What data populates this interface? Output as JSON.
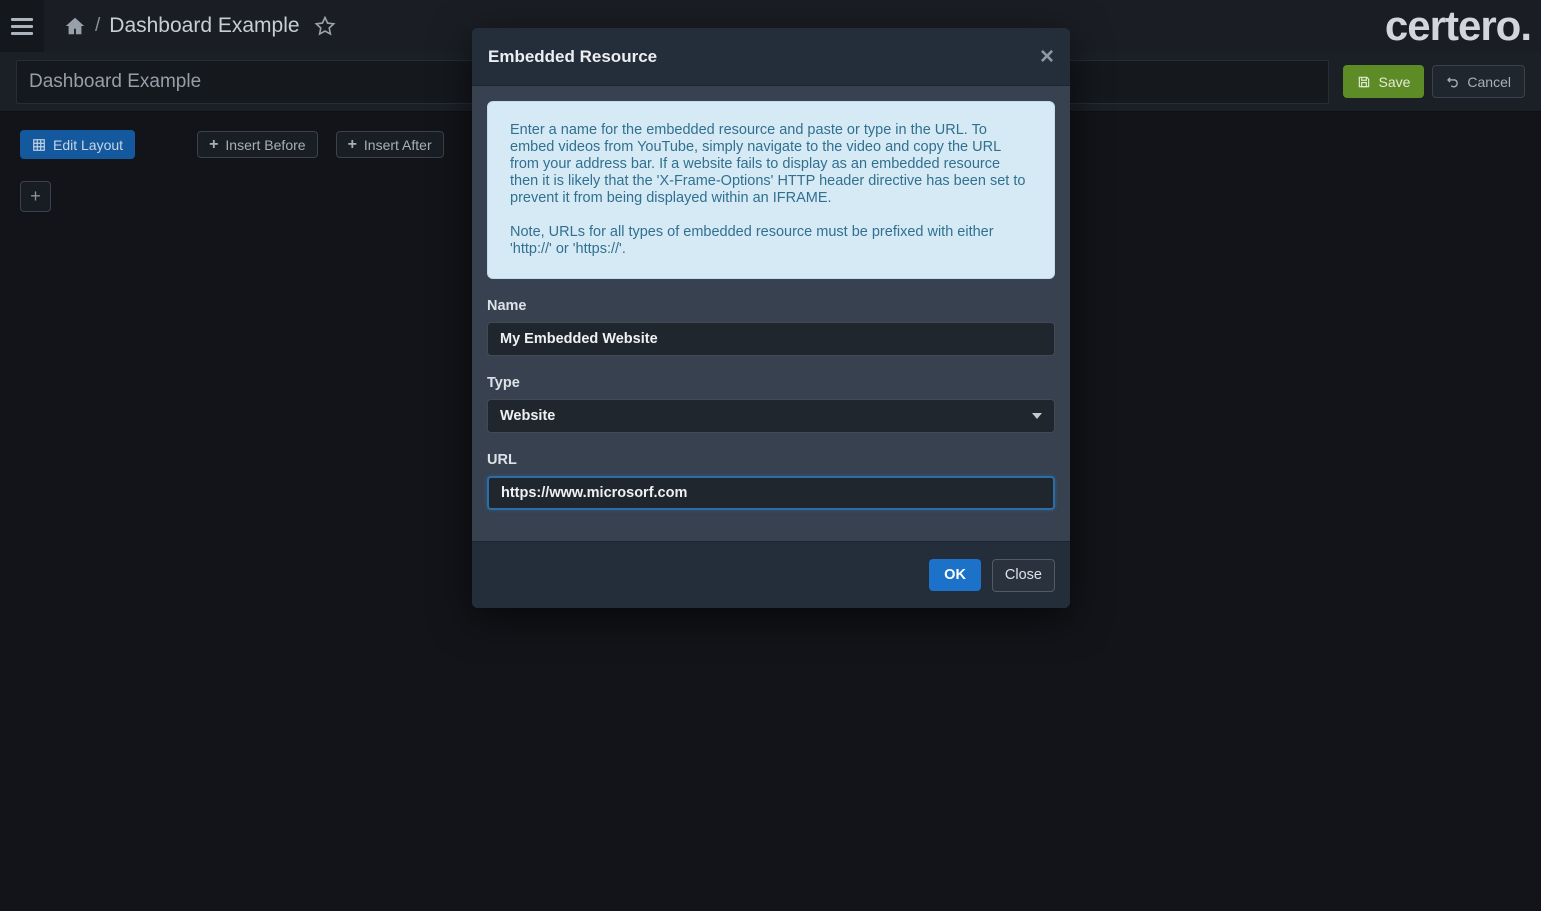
{
  "topbar": {
    "breadcrumb_separator": "/",
    "breadcrumb_title": "Dashboard Example",
    "logo": "certero."
  },
  "toolbar": {
    "title_value": "Dashboard Example",
    "save_label": "Save",
    "cancel_label": "Cancel"
  },
  "actions": {
    "edit_layout_label": "Edit Layout",
    "insert_before_label": "Insert Before",
    "insert_after_label": "Insert After",
    "plus_glyph": "+",
    "add_tile_label": "+"
  },
  "modal": {
    "title": "Embedded Resource",
    "close_glyph": "×",
    "info_paragraph1": "Enter a name for the embedded resource and paste or type in the URL. To embed videos from YouTube, simply navigate to the video and copy the URL from your address bar. If a website fails to display as an embedded resource then it is likely that the 'X-Frame-Options' HTTP header directive has been set to prevent it from being displayed within an IFRAME.",
    "info_paragraph2": "Note, URLs for all types of embedded resource must be prefixed with either 'http://' or 'https://'.",
    "fields": {
      "name_label": "Name",
      "name_value": "My Embedded Website",
      "type_label": "Type",
      "type_value": "Website",
      "url_label": "URL",
      "url_value": "https://www.microsorf.com"
    },
    "ok_label": "OK",
    "close_label": "Close"
  },
  "colors": {
    "accent_blue": "#1b72c8",
    "save_green": "#5d8b26",
    "edit_layout_blue": "#14599e",
    "info_bg": "#d6eaf6",
    "info_text": "#31708f",
    "modal_body": "#374150",
    "modal_chrome": "#242e3a",
    "page_bg": "#121419"
  }
}
